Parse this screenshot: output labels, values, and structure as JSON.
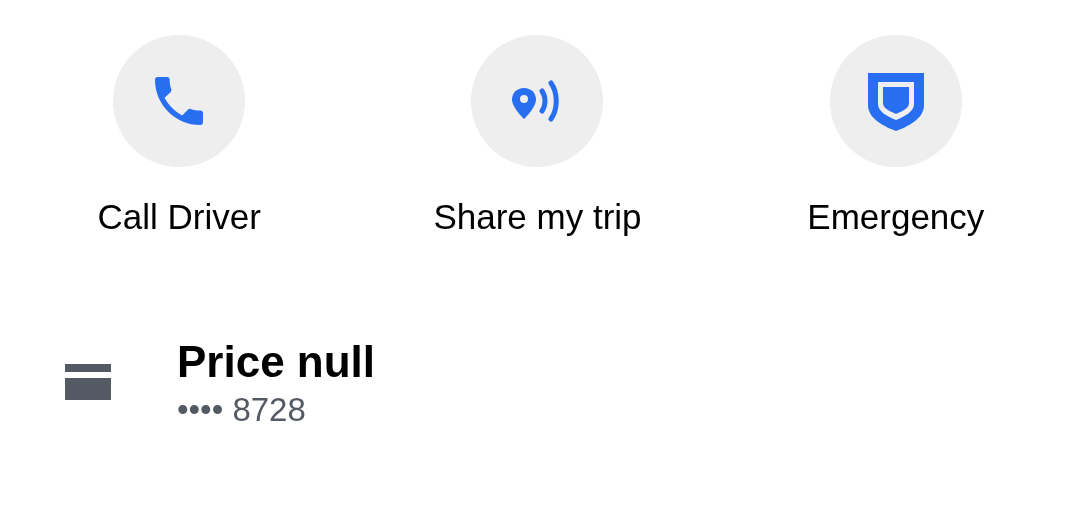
{
  "actions": [
    {
      "kind": "phone",
      "label": "Call Driver"
    },
    {
      "kind": "share",
      "label": "Share my trip"
    },
    {
      "kind": "shield",
      "label": "Emergency"
    }
  ],
  "payment": {
    "title": "Price null",
    "detail": "•••• 8728"
  }
}
